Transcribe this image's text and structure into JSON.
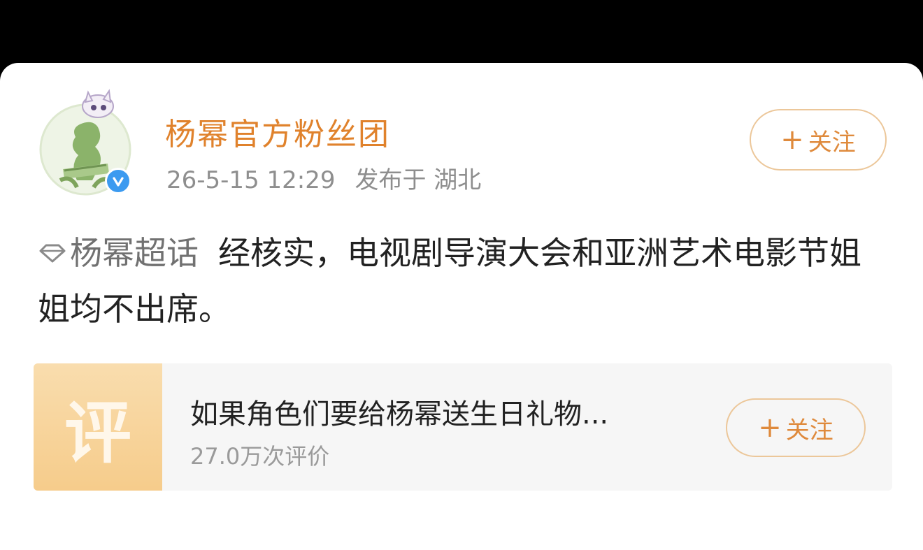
{
  "author": {
    "name": "杨幂官方粉丝团",
    "time": "26-5-15 12:29",
    "location": "发布于 湖北",
    "verified_icon": "verified-badge-icon",
    "follow_label": "关注"
  },
  "post": {
    "topic": "杨幂超话",
    "topic_icon": "diamond-icon",
    "text": "经核实，电视剧导演大会和亚洲艺术电影节姐姐均不出席。"
  },
  "embed": {
    "thumb_glyph": "评",
    "title": "如果角色们要给杨幂送生日礼物...",
    "subtitle": "27.0万次评价",
    "follow_label": "关注"
  },
  "colors": {
    "accent": "#e0822c",
    "follow_border": "#ecc79a",
    "thumb": "#f6cc8b",
    "verified": "#3b9af0"
  }
}
